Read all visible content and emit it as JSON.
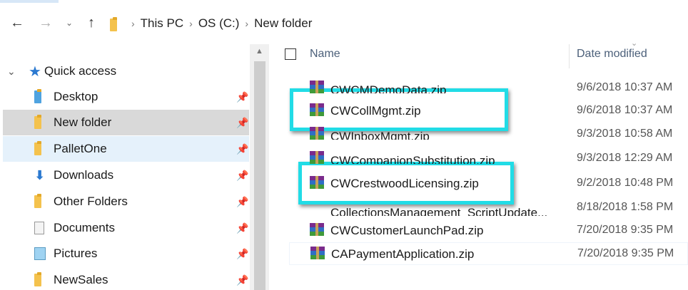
{
  "address_bar": {
    "back_icon": "arrow-left-icon",
    "forward_icon": "arrow-right-icon",
    "recent_icon": "chevron-down-icon",
    "up_icon": "arrow-up-icon",
    "breadcrumbs": [
      "This PC",
      "OS (C:)",
      "New folder"
    ]
  },
  "nav_pane": {
    "quick_access": "Quick access",
    "items": [
      {
        "label": "Desktop",
        "icon": "folder-blue-icon",
        "pinned": true
      },
      {
        "label": "New folder",
        "icon": "folder-icon",
        "pinned": true,
        "state": "selected"
      },
      {
        "label": "PalletOne",
        "icon": "folder-icon",
        "pinned": true,
        "state": "hover"
      },
      {
        "label": "Downloads",
        "icon": "download-icon",
        "pinned": true
      },
      {
        "label": "Other Folders",
        "icon": "folder-icon",
        "pinned": true
      },
      {
        "label": "Documents",
        "icon": "documents-icon",
        "pinned": true
      },
      {
        "label": "Pictures",
        "icon": "pictures-icon",
        "pinned": true
      },
      {
        "label": "NewSales",
        "icon": "folder-icon",
        "pinned": true
      }
    ]
  },
  "file_list": {
    "columns": {
      "name": "Name",
      "date_modified": "Date modified"
    },
    "files": [
      {
        "name": "CWCMDemoData.zip",
        "date": "9/6/2018 10:37 AM"
      },
      {
        "name": "CWCollMgmt.zip",
        "date": "9/6/2018 10:37 AM"
      },
      {
        "name": "CWInboxMgmt.zip",
        "date": "9/3/2018 10:58 AM"
      },
      {
        "name": "CWCompanionSubstitution.zip",
        "date": "9/3/2018 12:29 AM"
      },
      {
        "name": "CWCrestwoodLicensing.zip",
        "date": "9/2/2018 10:48 PM"
      },
      {
        "name": "CollectionsManagement_ScriptUpdate...",
        "date": "8/18/2018 1:58 PM"
      },
      {
        "name": "CWCustomerLaunchPad.zip",
        "date": "7/20/2018 9:35 PM"
      },
      {
        "name": "CAPaymentApplication.zip",
        "date": "7/20/2018 9:35 PM"
      }
    ]
  },
  "colors": {
    "highlight": "#21dce6",
    "selected_bg": "#d9d9d9",
    "hover_bg": "#e5f1fb",
    "header_text": "#4c607a"
  }
}
